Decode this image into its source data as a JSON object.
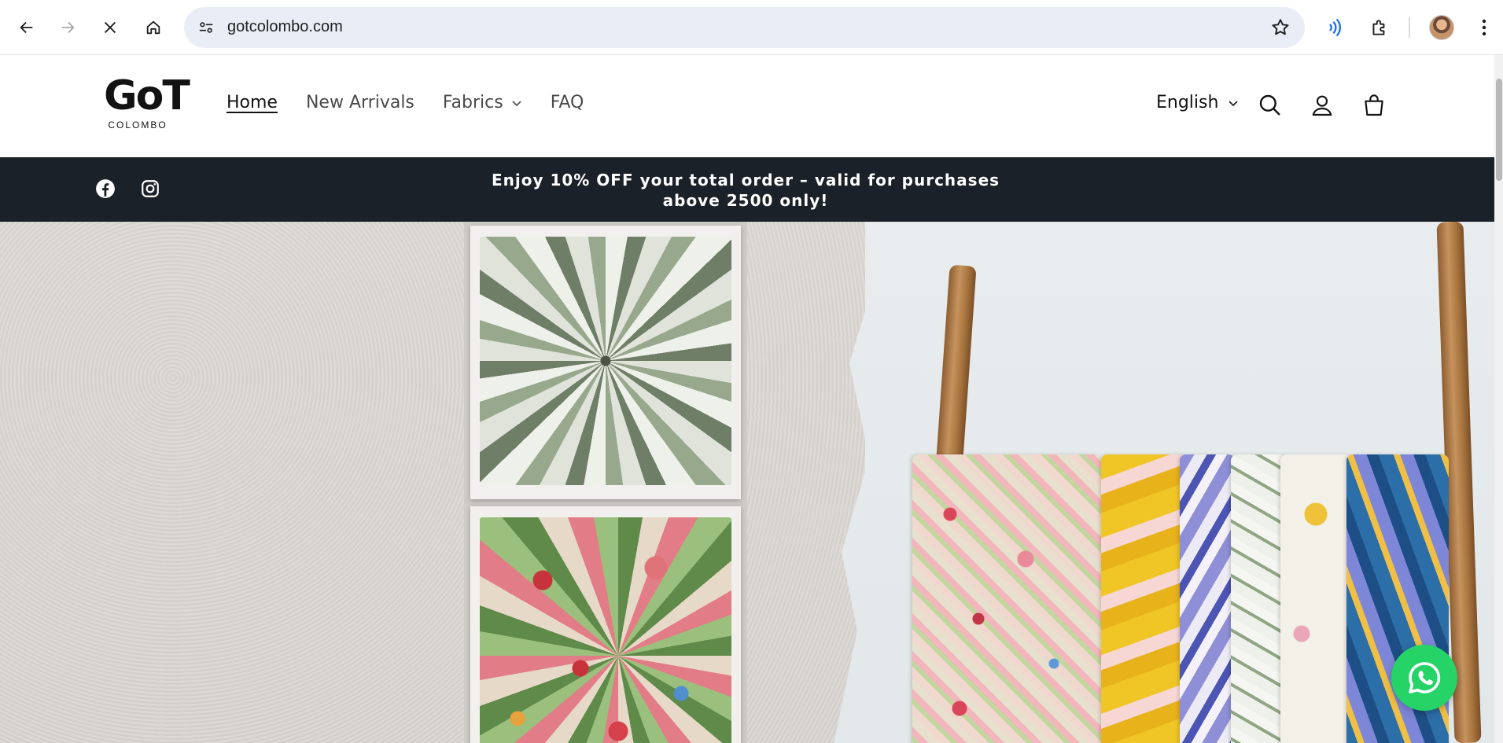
{
  "browser": {
    "url": "gotcolombo.com",
    "buttons": {
      "back": "back-arrow-icon",
      "forward": "forward-arrow-icon",
      "stop": "close-icon",
      "home": "home-icon"
    }
  },
  "header": {
    "logo_mark": "GoT",
    "logo_sub": "COLOMBO",
    "menu": [
      {
        "label": "Home",
        "active": true
      },
      {
        "label": "New Arrivals",
        "active": false
      },
      {
        "label": "Fabrics",
        "active": false,
        "dropdown": true
      },
      {
        "label": "FAQ",
        "active": false
      }
    ],
    "language": "English"
  },
  "announcement": {
    "text": "Enjoy 10% OFF your total order – valid for purchases above 2500 only!"
  },
  "colors": {
    "announcement_bg": "#1b2128",
    "whatsapp": "#25d366",
    "omnibox_bg": "#e9eef6"
  }
}
